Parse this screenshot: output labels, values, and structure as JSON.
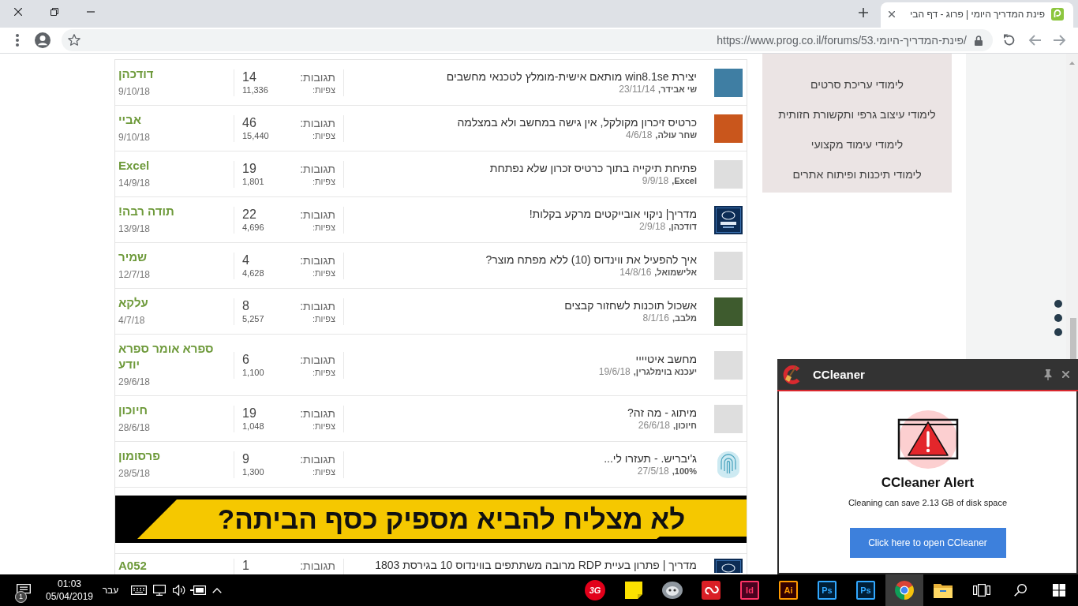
{
  "browser": {
    "tab_title": "פינת המדריך היומי | פרוג - דף הבי",
    "url": "https://www.prog.co.il/forums/53.פינת-המדריך-היומי/"
  },
  "forum": {
    "items": [
      {
        "kind": "thread",
        "thumb": {
          "kind": "photo",
          "color": "#3f7ea3"
        },
        "title": "יצירת win8.1se מותאם אישית-מומלץ לטכנאי מחשבים",
        "author": "שי אבידר,",
        "date": "23/11/14",
        "replies_label": "תגובות:",
        "replies": "14",
        "views_label": "צפיות:",
        "views": "11,336",
        "last_poster": "דודכהן",
        "last_date": "9/10/18"
      },
      {
        "kind": "thread",
        "thumb": {
          "kind": "photo",
          "color": "#c9561c"
        },
        "title": "כרטיס זיכרון מקולקל, אין גישה במחשב ולא במצלמה",
        "author": "שחר עולה,",
        "date": "4/6/18",
        "replies_label": "תגובות:",
        "replies": "46",
        "views_label": "צפיות:",
        "views": "15,440",
        "last_poster": "אביי",
        "last_date": "9/10/18"
      },
      {
        "kind": "thread",
        "thumb": {
          "kind": "logo"
        },
        "title": "פתיחת תיקייה בתוך כרטיס זכרון שלא נפתחת",
        "author": "Excel,",
        "date": "9/9/18",
        "replies_label": "תגובות:",
        "replies": "19",
        "views_label": "צפיות:",
        "views": "1,801",
        "last_poster": "Excel",
        "last_date": "14/9/18"
      },
      {
        "kind": "thread",
        "thumb": {
          "kind": "chip"
        },
        "title": "מדריך| ניקוי אובייקטים מרקע בקלות!",
        "author": "דודכהן,",
        "date": "2/9/18",
        "replies_label": "תגובות:",
        "replies": "22",
        "views_label": "צפיות:",
        "views": "4,696",
        "last_poster": "תודה רבה!",
        "last_date": "13/9/18"
      },
      {
        "kind": "thread",
        "thumb": {
          "kind": "logo"
        },
        "title": "איך להפעיל את ווינדוס (10) ללא מפתח מוצר?",
        "author": "אלישמואל,",
        "date": "14/8/16",
        "replies_label": "תגובות:",
        "replies": "4",
        "views_label": "צפיות:",
        "views": "4,628",
        "last_poster": "שמיר",
        "last_date": "12/7/18"
      },
      {
        "kind": "thread",
        "thumb": {
          "kind": "photo",
          "color": "#3e5b2e"
        },
        "title": "אשכול תוכנות לשחזור קבצים",
        "author": "מלבב,",
        "date": "8/1/16",
        "replies_label": "תגובות:",
        "replies": "8",
        "views_label": "צפיות:",
        "views": "5,257",
        "last_poster": "עלקא",
        "last_date": "4/7/18"
      },
      {
        "kind": "thread",
        "thumb": {
          "kind": "logo"
        },
        "title": "מחשב איטיייי",
        "author": "יעכנא בוימלגרין,",
        "date": "19/6/18",
        "replies_label": "תגובות:",
        "replies": "6",
        "views_label": "צפיות:",
        "views": "1,100",
        "last_poster": "ספרא אומר ספרא יודע",
        "last_date": "29/6/18"
      },
      {
        "kind": "thread",
        "thumb": {
          "kind": "logo"
        },
        "title": "מיתוג - מה זה?",
        "author": "חיוכון,",
        "date": "26/6/18",
        "replies_label": "תגובות:",
        "replies": "19",
        "views_label": "צפיות:",
        "views": "1,048",
        "last_poster": "חיוכון",
        "last_date": "28/6/18"
      },
      {
        "kind": "thread",
        "thumb": {
          "kind": "fingerprint"
        },
        "title": "ג'יבריש. - תעזרו לי...",
        "author": "100%,",
        "date": "27/5/18",
        "replies_label": "תגובות:",
        "replies": "9",
        "views_label": "צפיות:",
        "views": "1,300",
        "last_poster": "פרסומון",
        "last_date": "28/5/18"
      },
      {
        "kind": "ad",
        "headline": "לא מצליח להביא מספיק כסף הביתה?"
      },
      {
        "kind": "thread",
        "thumb": {
          "kind": "chip"
        },
        "title": "מדריך | פתרון בעיית RDP מרובה משתתפים בווינדוס 10 בגירסת 1803",
        "replies_label": "תגובות:",
        "replies": "1",
        "last_poster": "A052"
      }
    ]
  },
  "sidebar": {
    "items": [
      "לימודי עריכת סרטים",
      "לימודי עיצוב גרפי ותקשורת חזותית",
      "לימודי עימוד מקצועי",
      "לימודי תיכנות ופיתוח אתרים"
    ]
  },
  "popup": {
    "title": "CCleaner",
    "heading": "CCleaner Alert",
    "message": "Cleaning can save 2.13 GB of disk space",
    "button": "Click here to open CCleaner"
  },
  "taskbar": {
    "notification_count": "1",
    "time": "01:03",
    "date": "05/04/2019",
    "language": "עבר",
    "apps": [
      {
        "kind": "folder",
        "selected": false
      },
      {
        "kind": "chrome",
        "selected": true
      },
      {
        "kind": "ps",
        "label": "Ps",
        "selected": false
      },
      {
        "kind": "ps",
        "label": "Ps",
        "selected": false
      },
      {
        "kind": "ai",
        "label": "Ai",
        "selected": false
      },
      {
        "kind": "id",
        "label": "Id",
        "selected": false
      },
      {
        "kind": "cloud",
        "selected": false
      },
      {
        "kind": "app",
        "selected": false
      },
      {
        "kind": "sticky",
        "selected": false
      },
      {
        "kind": "badge",
        "label": "3G",
        "selected": false
      }
    ]
  }
}
